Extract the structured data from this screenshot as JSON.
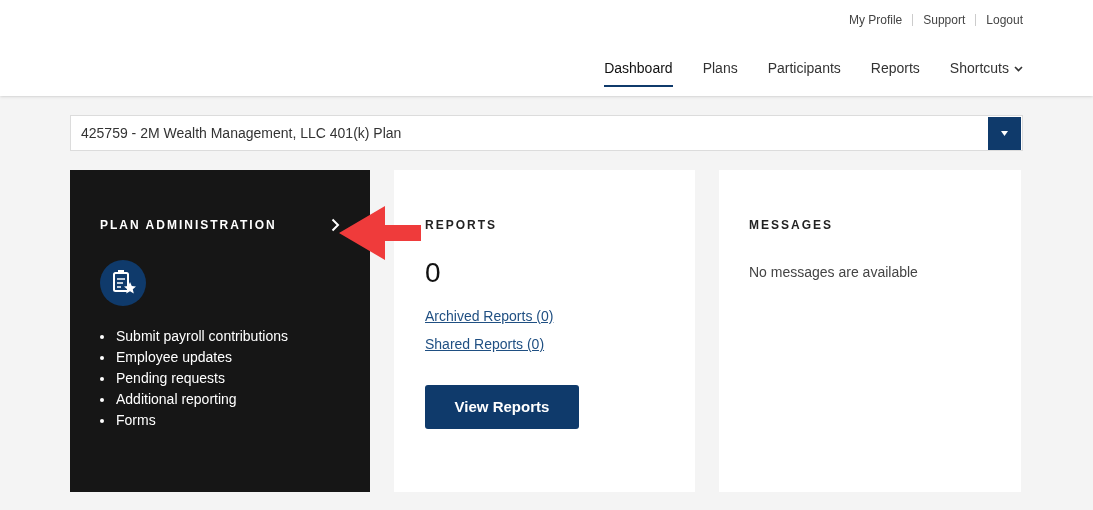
{
  "top_links": [
    "My Profile",
    "Support",
    "Logout"
  ],
  "nav": [
    {
      "label": "Dashboard",
      "selected": true,
      "dropdown": false
    },
    {
      "label": "Plans",
      "selected": false,
      "dropdown": false
    },
    {
      "label": "Participants",
      "selected": false,
      "dropdown": false
    },
    {
      "label": "Reports",
      "selected": false,
      "dropdown": false
    },
    {
      "label": "Shortcuts",
      "selected": false,
      "dropdown": true
    }
  ],
  "plan_select": {
    "value": "425759 - 2M Wealth Management, LLC 401(k) Plan"
  },
  "plan_admin": {
    "title": "PLAN ADMINISTRATION",
    "items": [
      "Submit payroll contributions",
      "Employee updates",
      "Pending requests",
      "Additional reporting",
      "Forms"
    ]
  },
  "reports": {
    "title": "REPORTS",
    "count": "0",
    "links": [
      "Archived Reports (0)",
      "Shared Reports (0)"
    ],
    "button": "View Reports"
  },
  "messages": {
    "title": "MESSAGES",
    "text": "No messages are available"
  }
}
